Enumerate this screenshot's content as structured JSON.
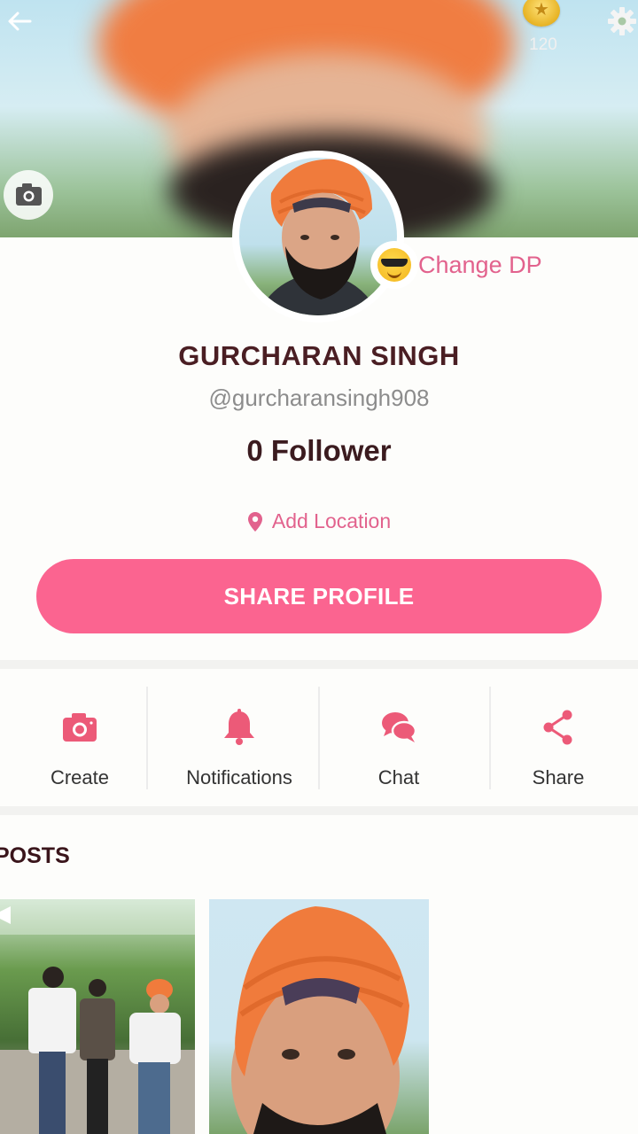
{
  "header": {
    "coins": "120",
    "back_icon": "back-arrow-icon",
    "settings_icon": "gear-icon"
  },
  "profile": {
    "change_dp_label": "Change DP",
    "name": "GURCHARAN SINGH",
    "handle": "@gurcharansingh908",
    "followers": "0 Follower",
    "location_label": "Add Location",
    "share_label": "SHARE PROFILE"
  },
  "actions": [
    {
      "label": "Create",
      "icon": "camera-icon"
    },
    {
      "label": "Notifications",
      "icon": "bell-icon"
    },
    {
      "label": "Chat",
      "icon": "chat-icon"
    },
    {
      "label": "Share",
      "icon": "share-icon"
    }
  ],
  "posts": {
    "title": "POSTS"
  },
  "colors": {
    "accent": "#fb6490",
    "accent_text": "#e2628d",
    "name_text": "#4a1e23"
  }
}
